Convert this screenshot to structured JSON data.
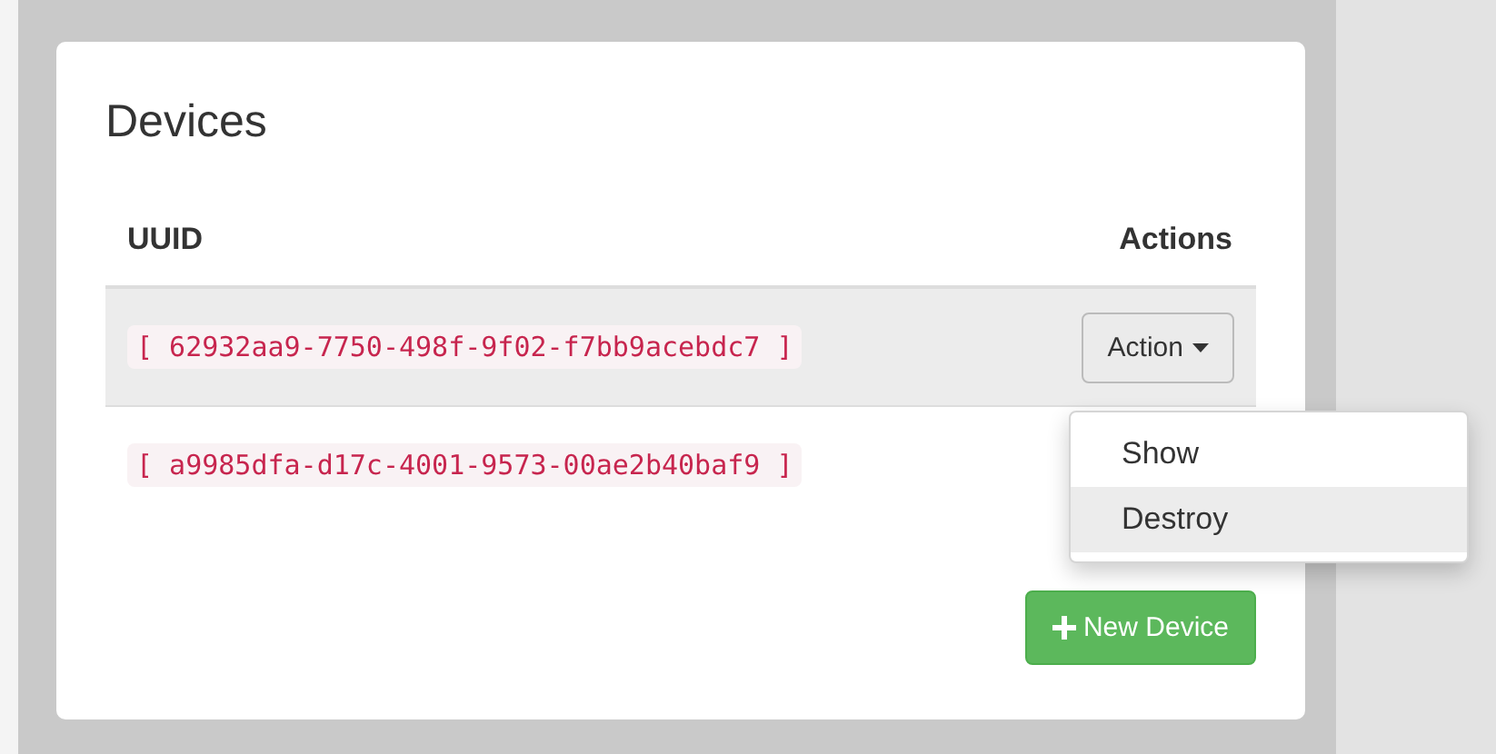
{
  "panel": {
    "title": "Devices"
  },
  "table": {
    "columns": [
      "UUID",
      "Actions"
    ],
    "rows": [
      {
        "uuid": "[ 62932aa9-7750-498f-9f02-f7bb9acebdc7 ]",
        "highlighted": true,
        "action": "Action"
      },
      {
        "uuid": "[ a9985dfa-d17c-4001-9573-00ae2b40baf9 ]",
        "highlighted": false
      }
    ]
  },
  "menu": {
    "items": [
      {
        "label": "Show",
        "selected": false
      },
      {
        "label": "Destroy",
        "selected": true
      }
    ]
  },
  "new_button": {
    "label": "New Device"
  }
}
